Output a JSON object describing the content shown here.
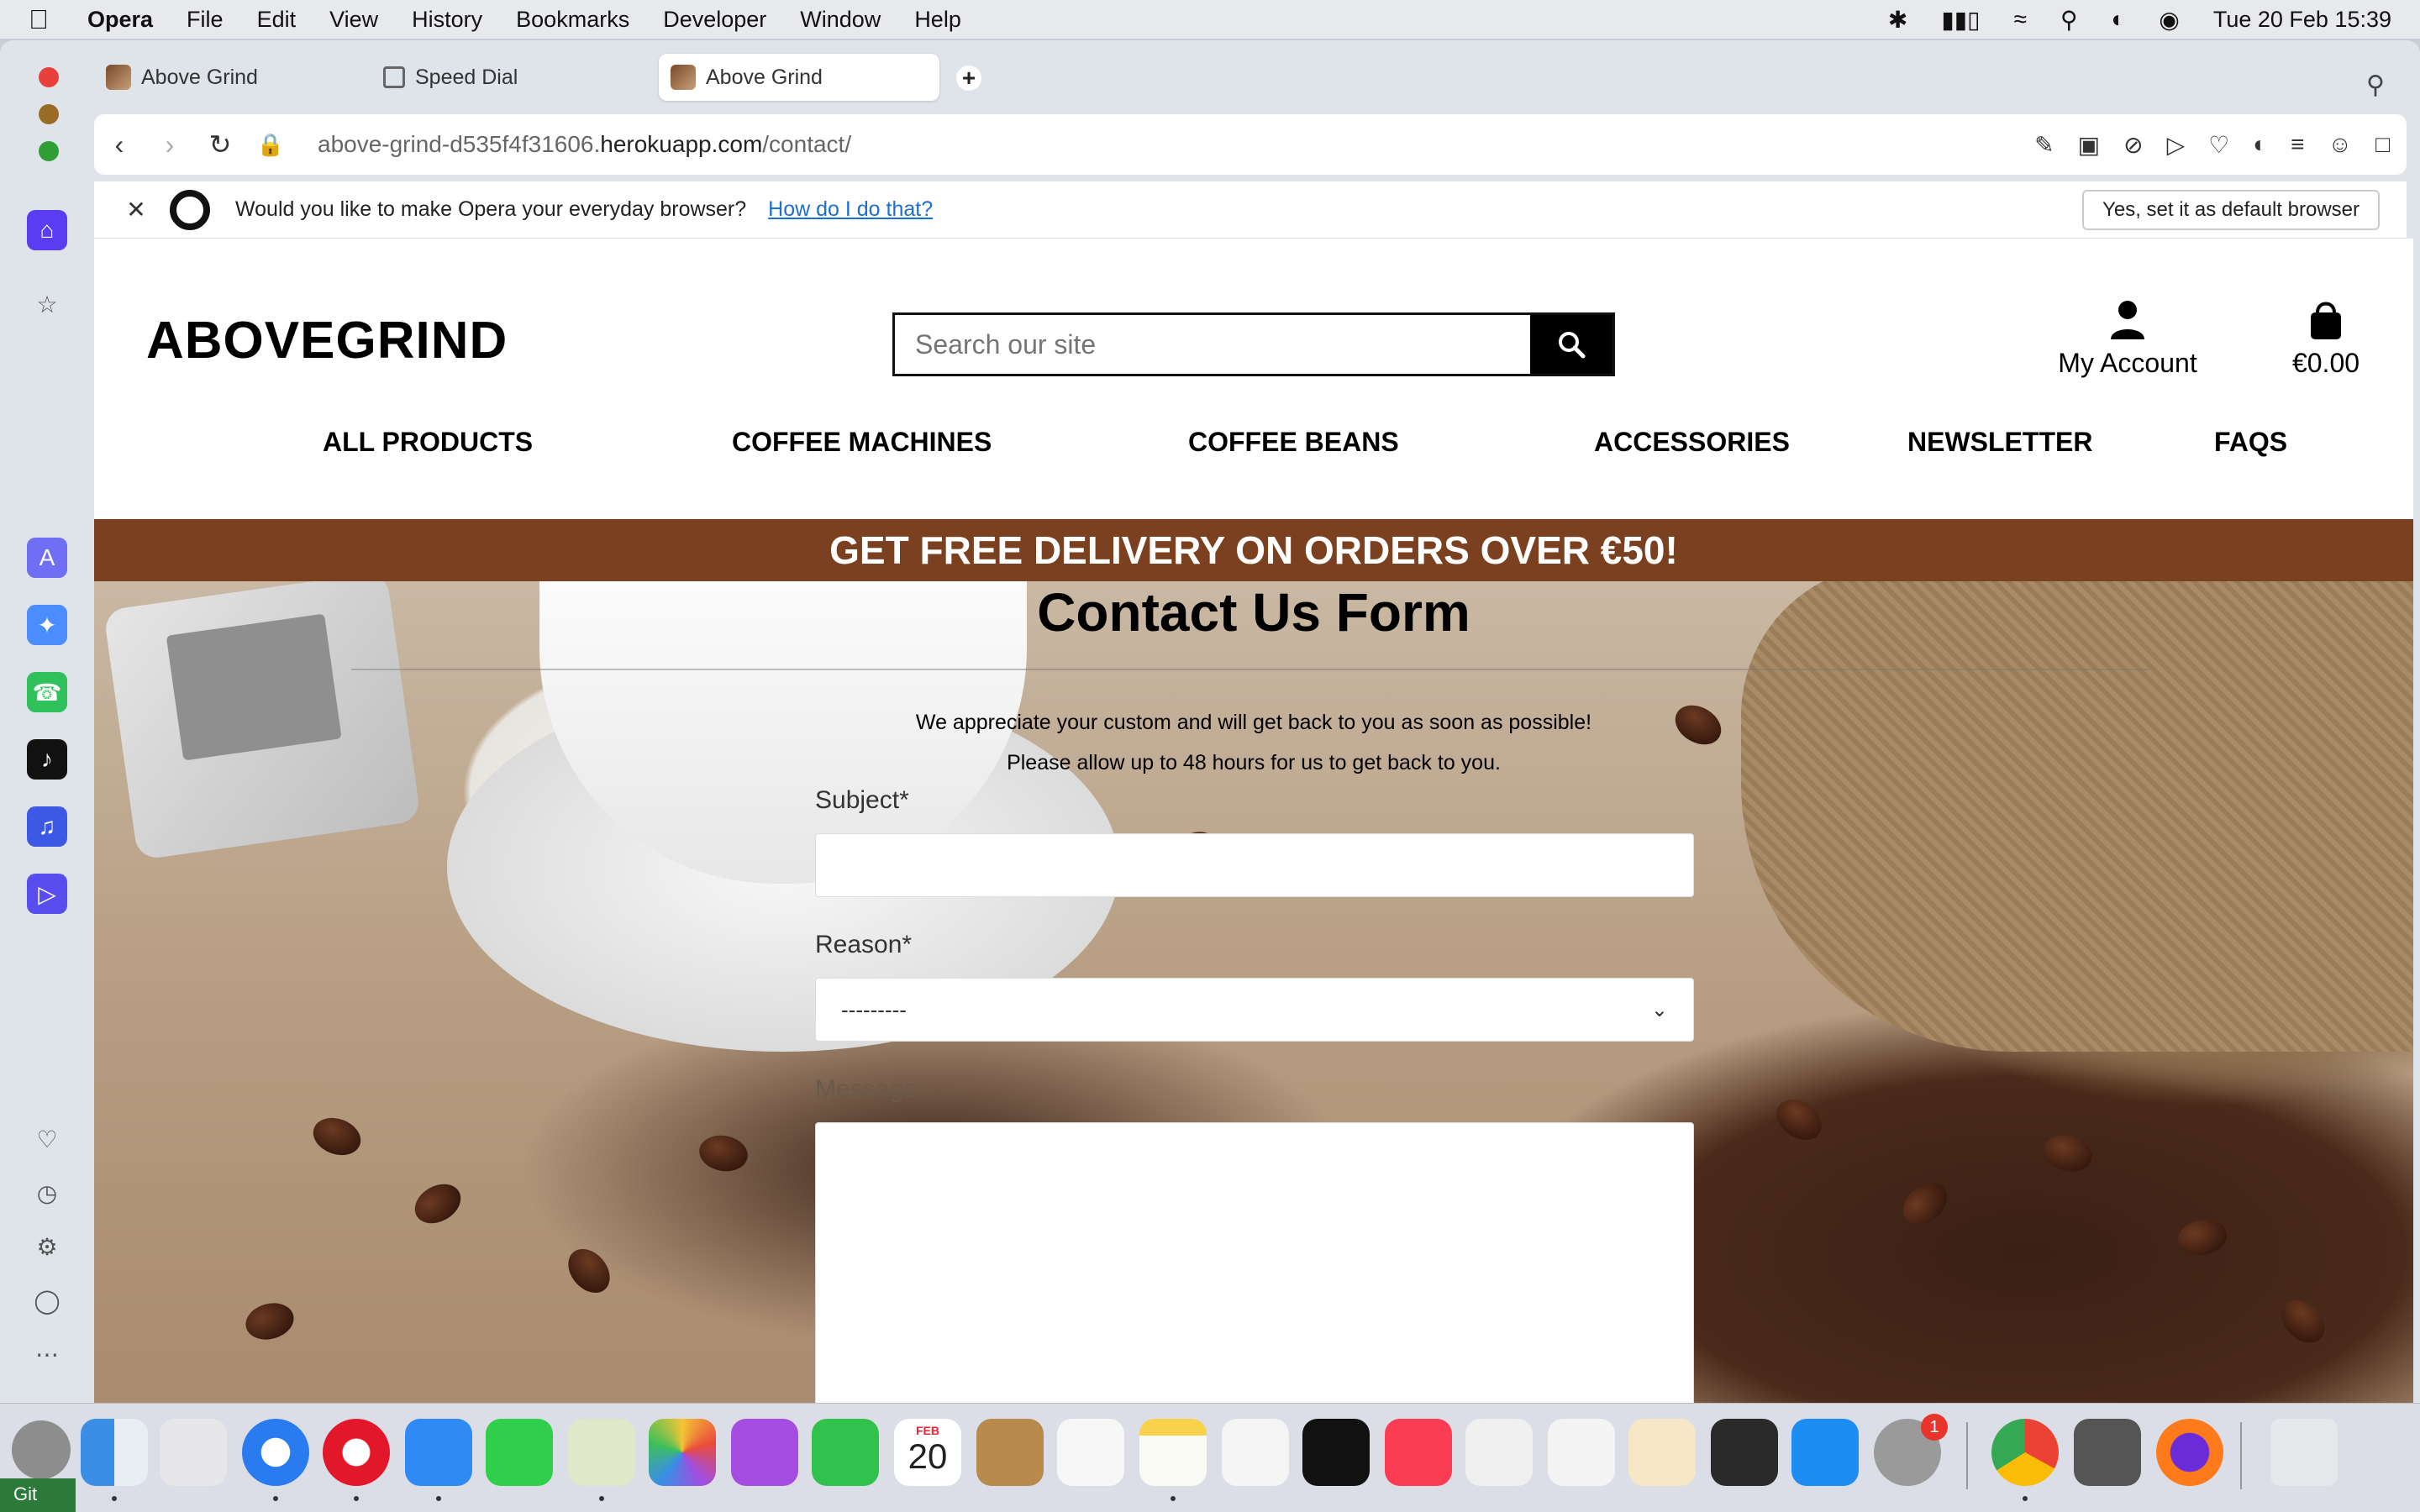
{
  "menubar": {
    "app": "Opera",
    "items": [
      "File",
      "Edit",
      "View",
      "History",
      "Bookmarks",
      "Developer",
      "Window",
      "Help"
    ],
    "datetime": "Tue 20 Feb  15:39"
  },
  "tabs": [
    {
      "label": "Above Grind"
    },
    {
      "label": "Speed Dial"
    },
    {
      "label": "Above Grind"
    }
  ],
  "address": {
    "prefix": "above-grind-d535f4f31606.",
    "host": "herokuapp.com",
    "path": "/contact/"
  },
  "prompt": {
    "question": "Would you like to make Opera your everyday browser?",
    "link": "How do I do that?",
    "button": "Yes, set it as default browser"
  },
  "site": {
    "logo": "ABOVEGRIND",
    "search_placeholder": "Search our site",
    "account_label": "My Account",
    "cart_total": "€0.00",
    "nav": [
      "ALL PRODUCTS",
      "COFFEE MACHINES",
      "COFFEE BEANS",
      "ACCESSORIES",
      "NEWSLETTER",
      "FAQS"
    ],
    "banner": "GET FREE DELIVERY ON ORDERS OVER €50!"
  },
  "form": {
    "title": "Contact Us Form",
    "note1": "We appreciate your custom and will get back to you as soon as possible!",
    "note2": "Please allow up to 48 hours for us to get back to you.",
    "subject_label": "Subject*",
    "subject_value": "",
    "reason_label": "Reason*",
    "reason_value": "---------",
    "message_label": "Message",
    "message_value": ""
  },
  "dock": {
    "calendar_month": "FEB",
    "calendar_day": "20",
    "settings_badge": "1",
    "git_label": "Git"
  },
  "colors": {
    "banner": "#7a4020",
    "opera_accent": "#5a3df0",
    "link": "#1a6fd1"
  }
}
